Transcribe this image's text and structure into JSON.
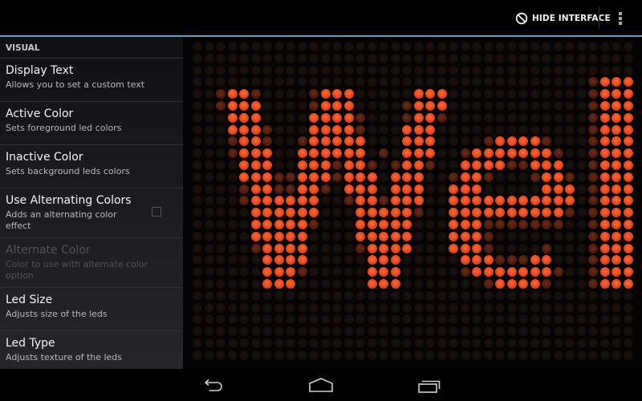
{
  "action_bar": {
    "hide_interface_label": "HIDE INTERFACE",
    "hide_icon": "block-icon",
    "overflow_icon": "overflow-menu-icon",
    "accent_color": "#5f9fbd"
  },
  "sidebar": {
    "section_header": "VISUAL",
    "items": [
      {
        "title": "Display Text",
        "summary": "Allows you to set a custom text",
        "enabled": true
      },
      {
        "title": "Active Color",
        "summary": "Sets foreground led colors",
        "enabled": true
      },
      {
        "title": "Inactive Color",
        "summary": "Sets background leds colors",
        "enabled": true
      },
      {
        "title": "Use Alternating Colors",
        "summary": "Adds an alternating color effect",
        "enabled": true,
        "checkbox": false
      },
      {
        "title": "Alternate Color",
        "summary": "Color to use with alternate color option",
        "enabled": false
      },
      {
        "title": "Led Size",
        "summary": "Adjusts size of the leds",
        "enabled": true
      },
      {
        "title": "Led Type",
        "summary": "Adjusts texture of the leds",
        "enabled": true
      }
    ]
  },
  "led_display": {
    "active_color": "#e8461b",
    "inactive_color": "#1c1410",
    "columns": 38,
    "rows": 27,
    "lit": {
      "3": {
        "on": [
          35,
          36,
          37
        ],
        "dim": [
          34
        ]
      },
      "4": {
        "on": [
          3,
          4,
          11,
          12,
          13,
          19,
          20,
          21,
          35,
          36,
          37
        ],
        "dim": [
          2,
          5,
          10,
          34
        ]
      },
      "5": {
        "on": [
          3,
          4,
          5,
          11,
          12,
          13,
          19,
          20,
          21,
          35,
          36,
          37
        ],
        "dim": [
          2,
          10,
          18,
          34
        ]
      },
      "6": {
        "on": [
          3,
          4,
          5,
          10,
          11,
          12,
          13,
          19,
          20,
          35,
          36,
          37
        ],
        "dim": [
          14,
          18,
          21,
          34
        ]
      },
      "7": {
        "on": [
          3,
          4,
          5,
          10,
          11,
          12,
          13,
          18,
          19,
          20,
          35,
          36,
          37
        ],
        "dim": [
          6,
          14,
          34
        ]
      },
      "8": {
        "on": [
          4,
          5,
          10,
          11,
          12,
          13,
          14,
          18,
          19,
          20,
          26,
          27,
          28,
          29,
          35,
          36,
          37
        ],
        "dim": [
          3,
          6,
          9,
          25,
          30,
          34
        ]
      },
      "9": {
        "on": [
          4,
          5,
          6,
          9,
          10,
          11,
          12,
          13,
          14,
          18,
          19,
          20,
          24,
          25,
          26,
          27,
          28,
          29,
          30,
          35,
          36,
          37
        ],
        "dim": [
          3,
          16,
          23,
          31,
          34
        ]
      },
      "10": {
        "on": [
          4,
          5,
          6,
          9,
          10,
          11,
          13,
          14,
          18,
          19,
          23,
          24,
          25,
          26,
          29,
          30,
          31,
          35,
          36,
          37
        ],
        "dim": [
          12,
          15,
          17,
          20,
          27,
          28,
          34
        ]
      },
      "11": {
        "on": [
          4,
          5,
          6,
          9,
          10,
          11,
          13,
          14,
          15,
          17,
          18,
          19,
          23,
          24,
          30,
          31,
          35,
          36,
          37
        ],
        "dim": [
          7,
          8,
          12,
          22,
          25,
          29,
          32,
          34
        ]
      },
      "12": {
        "on": [
          5,
          6,
          9,
          10,
          13,
          14,
          15,
          17,
          18,
          19,
          22,
          23,
          24,
          30,
          31,
          32,
          35,
          36,
          37
        ],
        "dim": [
          4,
          7,
          8,
          11,
          34
        ]
      },
      "13": {
        "on": [
          5,
          6,
          7,
          8,
          9,
          10,
          14,
          15,
          17,
          18,
          19,
          22,
          23,
          24,
          25,
          26,
          27,
          28,
          29,
          30,
          31,
          32,
          35,
          36,
          37
        ],
        "dim": [
          4,
          13,
          16,
          34
        ]
      },
      "14": {
        "on": [
          5,
          6,
          7,
          8,
          9,
          10,
          14,
          15,
          16,
          17,
          18,
          22,
          23,
          24,
          25,
          26,
          27,
          28,
          29,
          30,
          31,
          35,
          36,
          37
        ],
        "dim": [
          19,
          32,
          34
        ]
      },
      "15": {
        "on": [
          5,
          6,
          7,
          8,
          9,
          14,
          15,
          16,
          17,
          18,
          22,
          23,
          24,
          35,
          36,
          37
        ],
        "dim": [
          10,
          25,
          26,
          27,
          28,
          29,
          30,
          31,
          34
        ]
      },
      "16": {
        "on": [
          5,
          6,
          7,
          8,
          9,
          14,
          15,
          16,
          17,
          18,
          22,
          23,
          24,
          35,
          36,
          37
        ],
        "dim": [
          25,
          34
        ]
      },
      "17": {
        "on": [
          6,
          7,
          8,
          9,
          15,
          16,
          17,
          18,
          22,
          23,
          24,
          35,
          36,
          37
        ],
        "dim": [
          5,
          14,
          25,
          30,
          34
        ]
      },
      "18": {
        "on": [
          6,
          7,
          8,
          9,
          15,
          16,
          17,
          23,
          24,
          25,
          29,
          30,
          35,
          36,
          37
        ],
        "dim": [
          26,
          27,
          28,
          34
        ]
      },
      "19": {
        "on": [
          6,
          7,
          8,
          15,
          16,
          17,
          24,
          25,
          26,
          27,
          28,
          29,
          30,
          35,
          36,
          37
        ],
        "dim": [
          9,
          23,
          31,
          34
        ]
      },
      "20": {
        "on": [
          6,
          7,
          8,
          15,
          16,
          17,
          26,
          27,
          28,
          29,
          35,
          36,
          37
        ],
        "dim": [
          25,
          30,
          34
        ]
      }
    }
  },
  "nav_bar": {
    "back_icon": "back-icon",
    "home_icon": "home-icon",
    "recents_icon": "recent-apps-icon"
  }
}
